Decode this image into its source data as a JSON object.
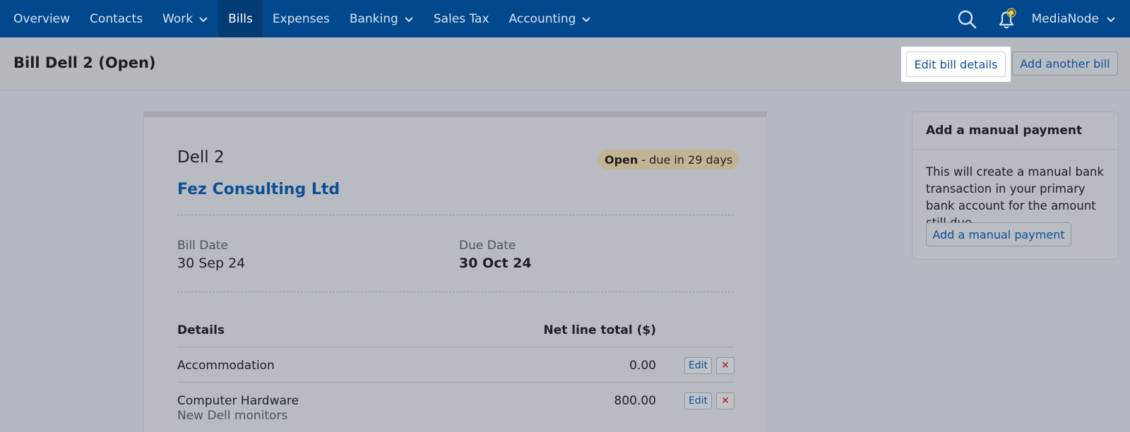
{
  "nav": {
    "items": [
      {
        "label": "Overview"
      },
      {
        "label": "Contacts"
      },
      {
        "label": "Work"
      },
      {
        "label": "Bills"
      },
      {
        "label": "Expenses"
      },
      {
        "label": "Banking"
      },
      {
        "label": "Sales Tax"
      },
      {
        "label": "Accounting"
      }
    ],
    "active": "Bills",
    "account_name": "MediaNode"
  },
  "header": {
    "title": "Bill Dell 2 (Open)",
    "edit_button": "Edit bill details",
    "add_button": "Add another bill"
  },
  "bill": {
    "reference": "Dell 2",
    "supplier": "Fez Consulting Ltd",
    "status": "Open",
    "status_suffix": "- due in 29 days",
    "bill_date_label": "Bill Date",
    "bill_date": "30 Sep 24",
    "due_date_label": "Due Date",
    "due_date": "30 Oct 24",
    "table": {
      "col_details": "Details",
      "col_total": "Net line total ($)",
      "rows": [
        {
          "category": "Accommodation",
          "description": "",
          "amount": "0.00",
          "edit": "Edit",
          "delete": "✕"
        },
        {
          "category": "Computer Hardware",
          "description": "New Dell monitors",
          "amount": "800.00",
          "edit": "Edit",
          "delete": "✕"
        }
      ]
    }
  },
  "payment_panel": {
    "title": "Add a manual payment",
    "text": "This will create a manual bank transaction in your primary bank account for the amount still due.",
    "button": "Add a manual payment"
  },
  "colors": {
    "nav_bg": "#02488c",
    "link": "#0d4f96",
    "status_pill": "#c2b493",
    "delete": "#b3161b"
  }
}
